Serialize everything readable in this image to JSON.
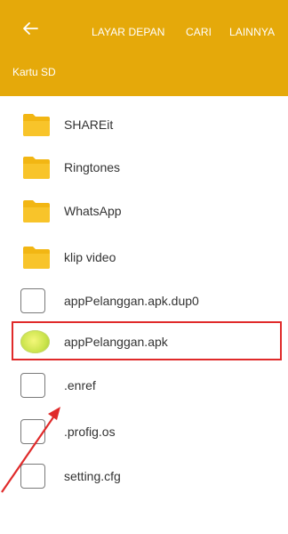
{
  "appbar": {
    "actions": [
      "LAYAR DEPAN",
      "CARI",
      "LAINNYA"
    ],
    "breadcrumb": "Kartu SD",
    "color": "#e5a90a"
  },
  "files": [
    {
      "name": "SHAREit",
      "type": "folder"
    },
    {
      "name": "Ringtones",
      "type": "folder"
    },
    {
      "name": "WhatsApp",
      "type": "folder"
    },
    {
      "name": "klip video",
      "type": "folder"
    },
    {
      "name": "appPelanggan.apk.dup0",
      "type": "file"
    },
    {
      "name": "appPelanggan.apk",
      "type": "apk",
      "highlighted": true
    },
    {
      "name": ".enref",
      "type": "file"
    },
    {
      "name": ".profig.os",
      "type": "file"
    },
    {
      "name": "setting.cfg",
      "type": "file"
    }
  ],
  "annotation": {
    "color": "#e02a2a"
  }
}
